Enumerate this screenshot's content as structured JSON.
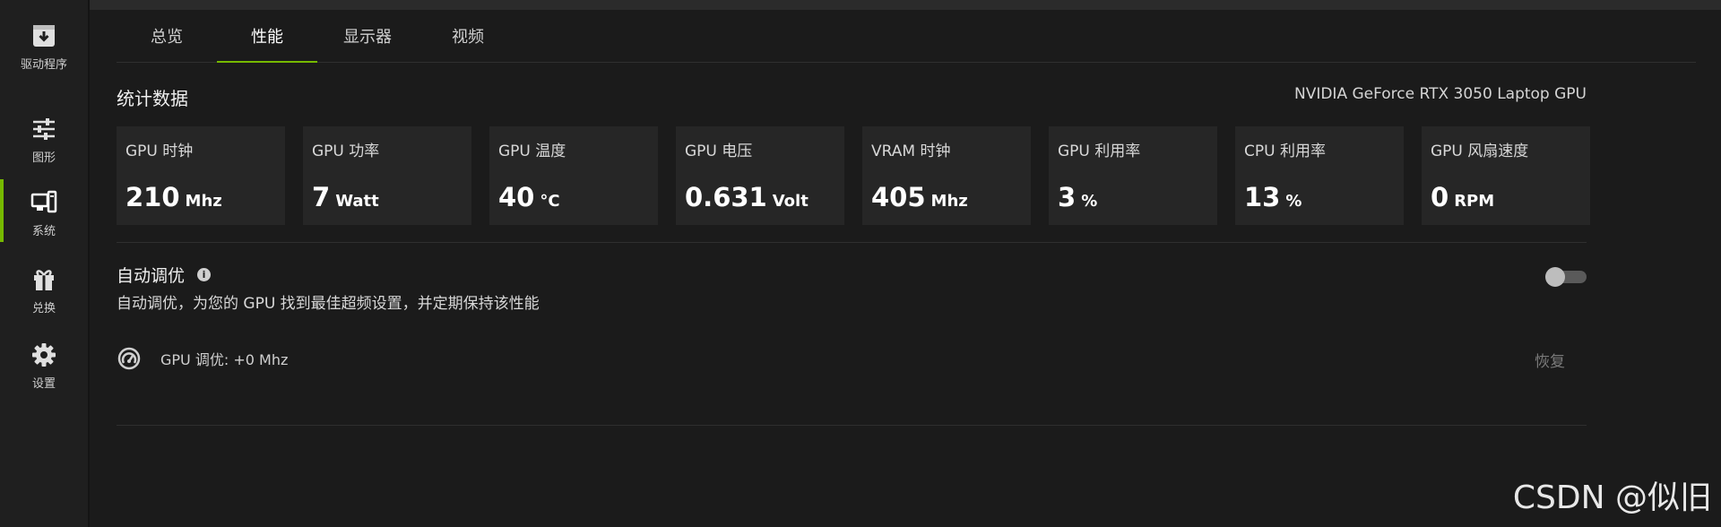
{
  "sidebar": {
    "items": [
      {
        "label": "驱动程序",
        "icon": "download-icon"
      },
      {
        "label": "图形",
        "icon": "sliders-icon"
      },
      {
        "label": "系统",
        "icon": "monitor-icon"
      },
      {
        "label": "兑换",
        "icon": "gift-icon"
      },
      {
        "label": "设置",
        "icon": "gear-icon"
      }
    ],
    "active_index": 2
  },
  "tabs": [
    "总览",
    "性能",
    "显示器",
    "视频"
  ],
  "active_tab": 1,
  "stats": {
    "title": "统计数据",
    "gpu_name": "NVIDIA GeForce RTX 3050 Laptop GPU",
    "cards": [
      {
        "label": "GPU 时钟",
        "value": "210",
        "unit": "Mhz"
      },
      {
        "label": "GPU 功率",
        "value": "7",
        "unit": "Watt"
      },
      {
        "label": "GPU 温度",
        "value": "40",
        "unit": "°C"
      },
      {
        "label": "GPU 电压",
        "value": "0.631",
        "unit": "Volt"
      },
      {
        "label": "VRAM 时钟",
        "value": "405",
        "unit": "Mhz"
      },
      {
        "label": "GPU 利用率",
        "value": "3",
        "unit": "%"
      },
      {
        "label": "CPU 利用率",
        "value": "13",
        "unit": "%"
      },
      {
        "label": "GPU 风扇速度",
        "value": "0",
        "unit": "RPM"
      }
    ]
  },
  "auto_tune": {
    "title": "自动调优",
    "description": "自动调优，为您的 GPU 找到最佳超频设置，并定期保持该性能",
    "enabled": false,
    "gpu_tune_label": "GPU 调优:",
    "gpu_tune_value": "+0 Mhz",
    "restore_label": "恢复"
  },
  "colors": {
    "accent": "#76b900",
    "background": "#1b1b1b",
    "card": "#262626"
  },
  "watermark": "CSDN @似旧"
}
